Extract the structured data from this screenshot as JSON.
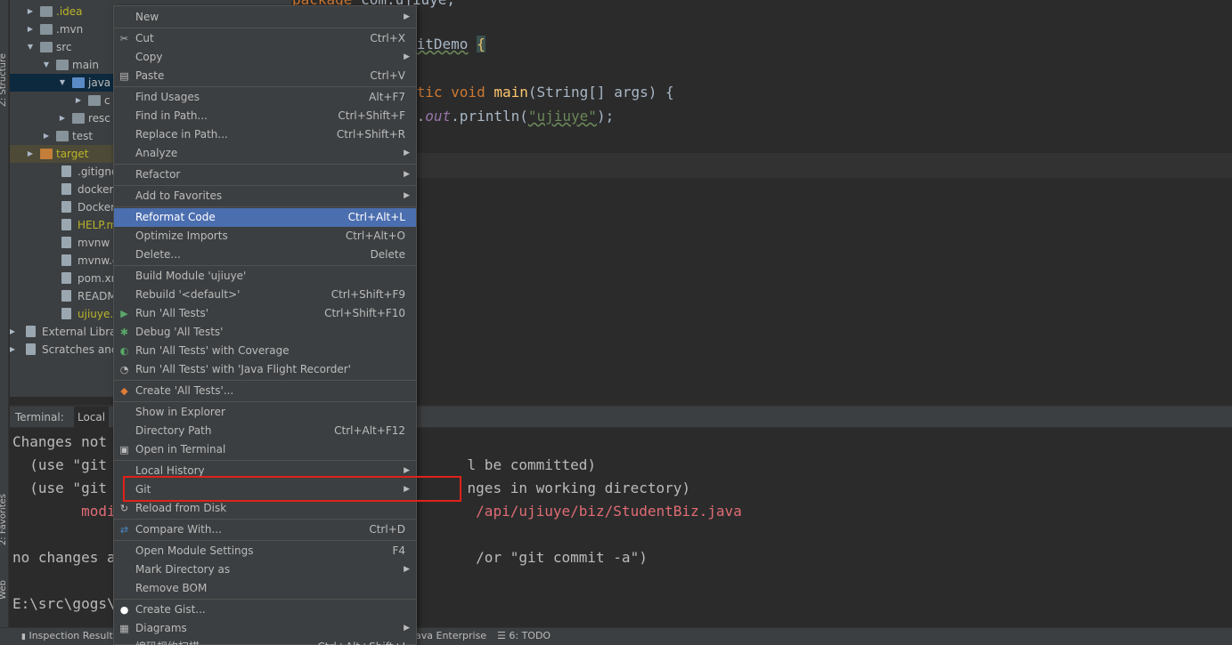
{
  "tree": [
    {
      "label": ".idea",
      "indent": 0,
      "arrow": "right",
      "icon": "folder-icon",
      "color": "#bbb529"
    },
    {
      "label": ".mvn",
      "indent": 0,
      "arrow": "right",
      "icon": "folder-icon"
    },
    {
      "label": "src",
      "indent": 0,
      "arrow": "down",
      "icon": "folder-icon"
    },
    {
      "label": "main",
      "indent": 1,
      "arrow": "down",
      "icon": "folder-icon"
    },
    {
      "label": "java",
      "indent": 2,
      "arrow": "down",
      "icon": "folder-blue-icon",
      "selected": true
    },
    {
      "label": "c",
      "indent": 3,
      "arrow": "right",
      "icon": "folder-icon"
    },
    {
      "label": "resc",
      "indent": 2,
      "arrow": "right",
      "icon": "folder-icon"
    },
    {
      "label": "test",
      "indent": 1,
      "arrow": "right",
      "icon": "folder-icon"
    },
    {
      "label": "target",
      "indent": 0,
      "arrow": "right",
      "icon": "folder-orange-icon",
      "color": "#bbb529",
      "highlight": true
    },
    {
      "label": ".gitignore",
      "indent": 1,
      "icon": "gitignore-file-icon"
    },
    {
      "label": "docker-co",
      "indent": 1,
      "icon": "docker-file-icon"
    },
    {
      "label": "Dockerfile",
      "indent": 1,
      "icon": "docker-file-icon"
    },
    {
      "label": "HELP.md",
      "indent": 1,
      "icon": "markdown-file-icon",
      "color": "#bbb529"
    },
    {
      "label": "mvnw",
      "indent": 1,
      "icon": "script-file-icon"
    },
    {
      "label": "mvnw.cmd",
      "indent": 1,
      "icon": "text-file-icon"
    },
    {
      "label": "pom.xml",
      "indent": 1,
      "icon": "maven-file-icon"
    },
    {
      "label": "README.n",
      "indent": 1,
      "icon": "markdown-file-icon"
    },
    {
      "label": "ujiuye.iml",
      "indent": 1,
      "icon": "module-file-icon",
      "color": "#bbb529"
    },
    {
      "label": "External Libra",
      "indent": -1,
      "arrow": "right",
      "icon": "library-icon"
    },
    {
      "label": "Scratches and",
      "indent": -1,
      "arrow": "right",
      "icon": "scratches-icon"
    }
  ],
  "strip": {
    "structure": "Z: Structure",
    "favorites": "2: Favorites",
    "web": "Web"
  },
  "editor": {
    "line1_kw": "package",
    "line1_rest": " com.ujiuye;",
    "line2_name": "gitDemo",
    "line2_brace": "{",
    "line3_pre": "atic void ",
    "line3_fn": "main",
    "line3_post": "(String[] args) {",
    "line4_pre": "m.",
    "line4_it": "out",
    "line4_mid": ".println(",
    "line4_str": "\"ujiuye\"",
    "line4_post": ");"
  },
  "terminal": {
    "label": "Terminal:",
    "tab": "Local",
    "lines": [
      "Changes not",
      "  (use \"git                                          l be committed)",
      "  (use \"git                                          nges in working directory)",
      "        modi                                          /api/ujiuye/biz/StudentBiz.java",
      "",
      "no changes a                                          /or \"git commit -a\")",
      "",
      "E:\\src\\gogs\\"
    ]
  },
  "status": {
    "inspection": "Inspection Result",
    "java_ent": "ava Enterprise",
    "todo": "6: TODO"
  },
  "menu": [
    {
      "label": "New",
      "sub": true
    },
    {
      "sep": true
    },
    {
      "label": "Cut",
      "shortcut": "Ctrl+X",
      "icon": "scissors-icon"
    },
    {
      "label": "Copy",
      "sub": true
    },
    {
      "label": "Paste",
      "shortcut": "Ctrl+V",
      "icon": "paste-icon"
    },
    {
      "sep": true
    },
    {
      "label": "Find Usages",
      "shortcut": "Alt+F7"
    },
    {
      "label": "Find in Path...",
      "shortcut": "Ctrl+Shift+F"
    },
    {
      "label": "Replace in Path...",
      "shortcut": "Ctrl+Shift+R"
    },
    {
      "label": "Analyze",
      "sub": true
    },
    {
      "sep": true
    },
    {
      "label": "Refactor",
      "sub": true
    },
    {
      "sep": true
    },
    {
      "label": "Add to Favorites",
      "sub": true
    },
    {
      "sep": true
    },
    {
      "label": "Reformat Code",
      "shortcut": "Ctrl+Alt+L",
      "active": true
    },
    {
      "label": "Optimize Imports",
      "shortcut": "Ctrl+Alt+O"
    },
    {
      "label": "Delete...",
      "shortcut": "Delete"
    },
    {
      "sep": true
    },
    {
      "label": "Build Module 'ujiuye'"
    },
    {
      "label": "Rebuild '<default>'",
      "shortcut": "Ctrl+Shift+F9"
    },
    {
      "label": "Run 'All Tests'",
      "shortcut": "Ctrl+Shift+F10",
      "icon": "run-icon"
    },
    {
      "label": "Debug 'All Tests'",
      "icon": "debug-icon"
    },
    {
      "label": "Run 'All Tests' with Coverage",
      "icon": "coverage-icon"
    },
    {
      "label": "Run 'All Tests' with 'Java Flight Recorder'",
      "icon": "profiler-icon"
    },
    {
      "sep": true
    },
    {
      "label": "Create 'All Tests'...",
      "icon": "create-test-icon"
    },
    {
      "sep": true
    },
    {
      "label": "Show in Explorer"
    },
    {
      "label": "Directory Path",
      "shortcut": "Ctrl+Alt+F12"
    },
    {
      "label": "Open in Terminal",
      "icon": "terminal-icon"
    },
    {
      "sep": true
    },
    {
      "label": "Local History",
      "sub": true
    },
    {
      "label": "Git",
      "sub": true
    },
    {
      "label": "Reload from Disk",
      "icon": "reload-icon"
    },
    {
      "sep": true
    },
    {
      "label": "Compare With...",
      "shortcut": "Ctrl+D",
      "icon": "compare-icon"
    },
    {
      "sep": true
    },
    {
      "label": "Open Module Settings",
      "shortcut": "F4"
    },
    {
      "label": "Mark Directory as",
      "sub": true
    },
    {
      "label": "Remove BOM"
    },
    {
      "sep": true
    },
    {
      "label": "Create Gist...",
      "icon": "github-icon"
    },
    {
      "label": "Diagrams",
      "sub": true,
      "icon": "diagram-icon"
    },
    {
      "label": "编码规约扫描",
      "shortcut": "Ctrl+Alt+Shift+J"
    }
  ]
}
